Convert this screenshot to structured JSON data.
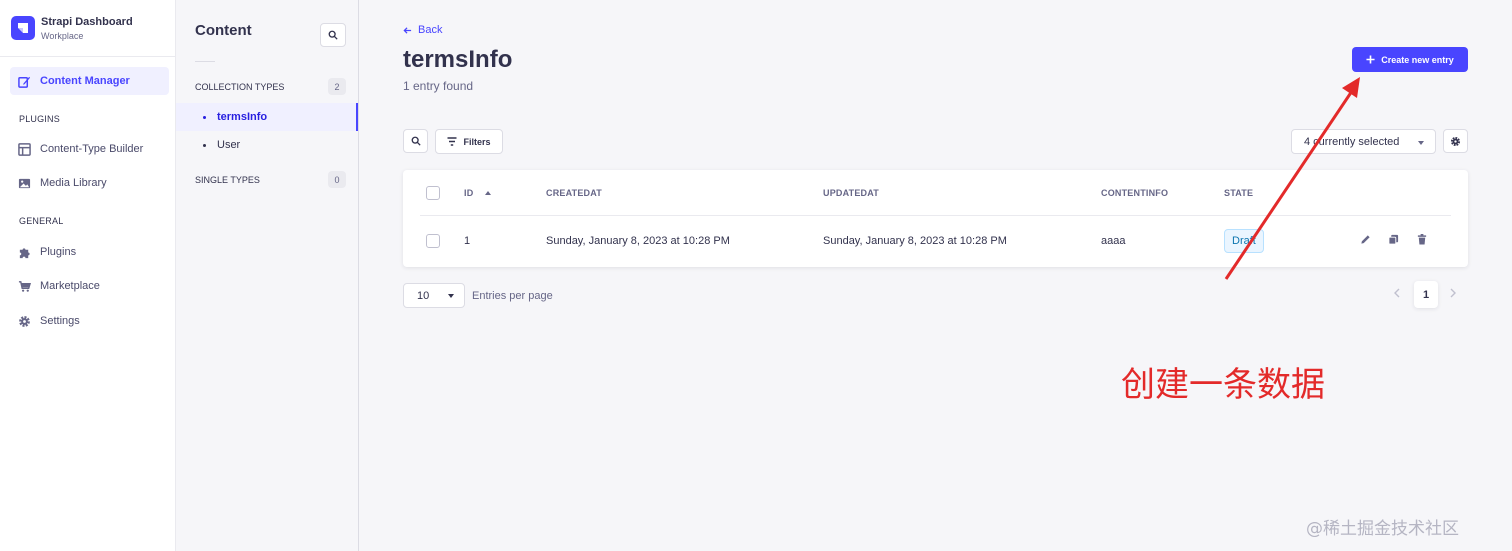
{
  "brand": {
    "title": "Strapi Dashboard",
    "subtitle": "Workplace"
  },
  "nav": {
    "active_item": "Content Manager",
    "plugins_heading": "PLUGINS",
    "plugins": [
      "Content-Type Builder",
      "Media Library"
    ],
    "general_heading": "GENERAL",
    "general": [
      "Plugins",
      "Marketplace",
      "Settings"
    ]
  },
  "subnav": {
    "title": "Content",
    "collection_heading": "COLLECTION TYPES",
    "collection_count": "2",
    "collection_items": [
      "termsInfo",
      "User"
    ],
    "single_heading": "SINGLE TYPES",
    "single_count": "0"
  },
  "header": {
    "back_label": "Back",
    "title": "termsInfo",
    "subtitle": "1 entry found",
    "create_label": "Create new entry"
  },
  "toolbar": {
    "filters_label": "Filters",
    "columns_selected": "4 currently selected"
  },
  "table": {
    "columns": [
      "ID",
      "CREATEDAT",
      "UPDATEDAT",
      "CONTENTINFO",
      "STATE"
    ],
    "rows": [
      {
        "id": "1",
        "createdAt": "Sunday, January 8, 2023 at 10:28 PM",
        "updatedAt": "Sunday, January 8, 2023 at 10:28 PM",
        "contentInfo": "aaaa",
        "state": "Draft"
      }
    ]
  },
  "pagination": {
    "per_page": "10",
    "per_page_label": "Entries per page",
    "current_page": "1"
  },
  "annotation": {
    "text": "创建一条数据",
    "color": "#e32a2a"
  },
  "watermark": "@稀土掘金技术社区",
  "colors": {
    "primary": "#4945ff",
    "draft_badge_bg": "#eaf5ff",
    "draft_badge_text": "#0c75af"
  }
}
